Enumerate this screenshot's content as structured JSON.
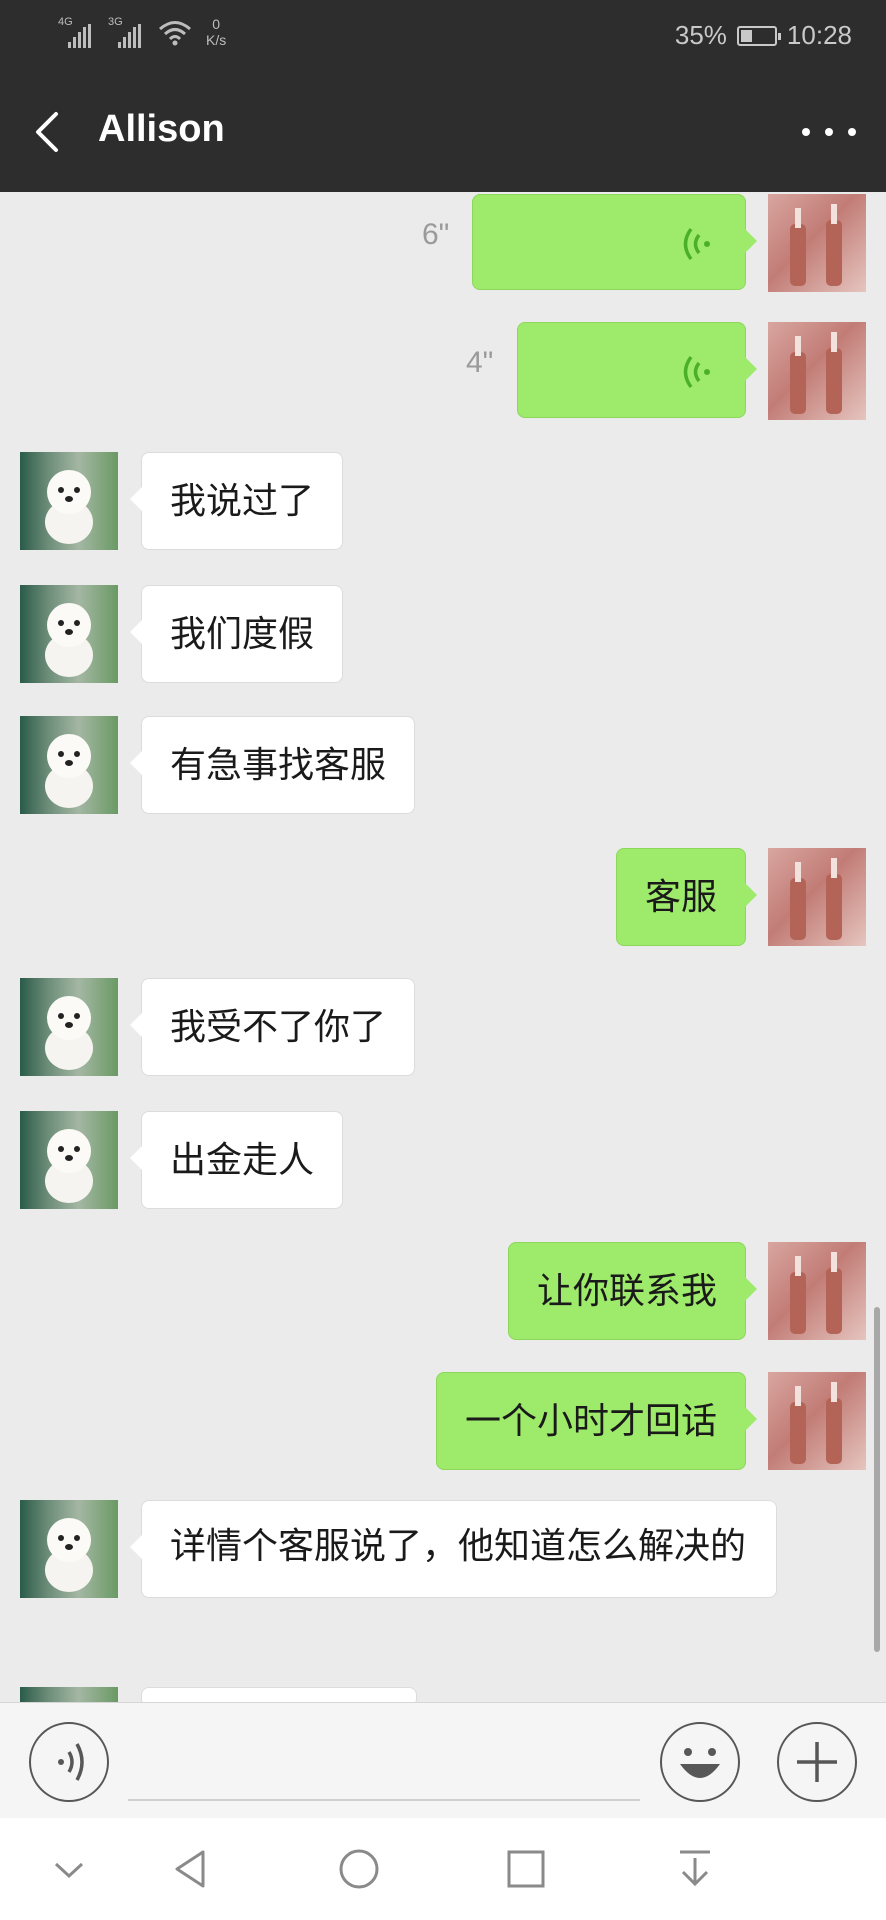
{
  "status_bar": {
    "signal_1": "4G",
    "signal_2": "3G",
    "net_speed_value": "0",
    "net_speed_unit": "K/s",
    "battery_percent": "35%",
    "battery_level": 0.35,
    "time": "10:28"
  },
  "header": {
    "title": "Allison"
  },
  "messages": [
    {
      "side": "right",
      "type": "voice",
      "duration": "6\""
    },
    {
      "side": "right",
      "type": "voice",
      "duration": "4\""
    },
    {
      "side": "left",
      "type": "text",
      "text": "我说过了"
    },
    {
      "side": "left",
      "type": "text",
      "text": "我们度假"
    },
    {
      "side": "left",
      "type": "text",
      "text": "有急事找客服"
    },
    {
      "side": "right",
      "type": "text",
      "text": "客服"
    },
    {
      "side": "left",
      "type": "text",
      "text": "我受不了你了"
    },
    {
      "side": "left",
      "type": "text",
      "text": "出金走人"
    },
    {
      "side": "right",
      "type": "text",
      "text": "让你联系我"
    },
    {
      "side": "right",
      "type": "text",
      "text": "一个小时才回话"
    },
    {
      "side": "left",
      "type": "text",
      "text": "详情个客服说了，他知道怎么解决的"
    }
  ],
  "input_bar": {
    "voice_icon": "voice-input-icon",
    "emoji_icon": "emoji-icon",
    "plus_icon": "plus-icon"
  },
  "nav_bar": {
    "icons": [
      "collapse-chevron-icon",
      "back-triangle-icon",
      "home-circle-icon",
      "recents-square-icon",
      "notification-pulldown-icon"
    ]
  },
  "colors": {
    "header_bg": "#2d2d2d",
    "chat_bg": "#ebebeb",
    "self_bubble": "#9eea6a",
    "friend_bubble": "#ffffff"
  }
}
